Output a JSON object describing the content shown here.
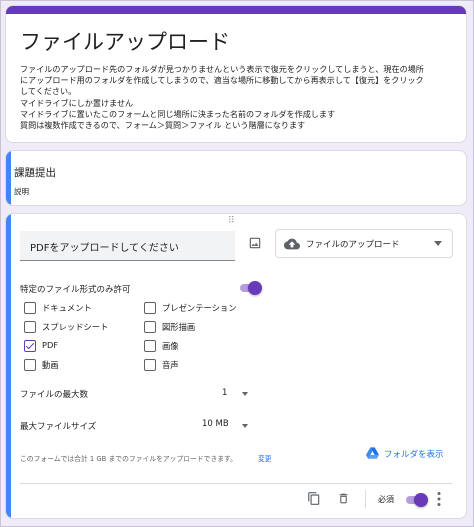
{
  "header": {
    "title": "ファイルアップロード",
    "description": [
      "ファイルのアップロード先のフォルダが見つかりませんという表示で復元をクリックしてしまうと、現在の場所",
      "にアップロード用のフォルダを作成してしまうので、適当な場所に移動してから再表示して【復元】をクリック",
      "してください。",
      "マイドライブにしか置けません",
      "マイドライブに置いたこのフォームと同じ場所に決まった名前のフォルダを作成します",
      "質問は複数作成できるので、フォーム＞質問＞ファイル という階層になります"
    ]
  },
  "section": {
    "title": "課題提出",
    "description": "説明"
  },
  "question": {
    "drag_handle": "⠿",
    "title": "PDFをアップロードしてください",
    "type_label": "ファイルのアップロード",
    "allow_specific_types_label": "特定のファイル形式のみ許可",
    "file_types": [
      {
        "label": "ドキュメント",
        "checked": false
      },
      {
        "label": "プレゼンテーション",
        "checked": false
      },
      {
        "label": "スプレッドシート",
        "checked": false
      },
      {
        "label": "図形描画",
        "checked": false
      },
      {
        "label": "PDF",
        "checked": true
      },
      {
        "label": "画像",
        "checked": false
      },
      {
        "label": "動画",
        "checked": false
      },
      {
        "label": "音声",
        "checked": false
      }
    ],
    "max_files_label": "ファイルの最大数",
    "max_files_value": "1",
    "max_size_label": "最大ファイルサイズ",
    "max_size_value": "10 MB",
    "footer_note": "このフォームでは合計 1 GB までのファイルをアップロードできます。",
    "change_link": "変更",
    "view_folder_label": "フォルダを表示",
    "required_label": "必須"
  },
  "colors": {
    "accent": "#673ab7",
    "accent_light": "#b39ddb",
    "link": "#1a73e8",
    "section_bar": "#4285f4",
    "background": "#f0ebf8"
  },
  "icons": [
    "image-icon",
    "cloud-upload-icon",
    "google-drive-icon",
    "copy-icon",
    "trash-icon",
    "more-vert-icon"
  ]
}
